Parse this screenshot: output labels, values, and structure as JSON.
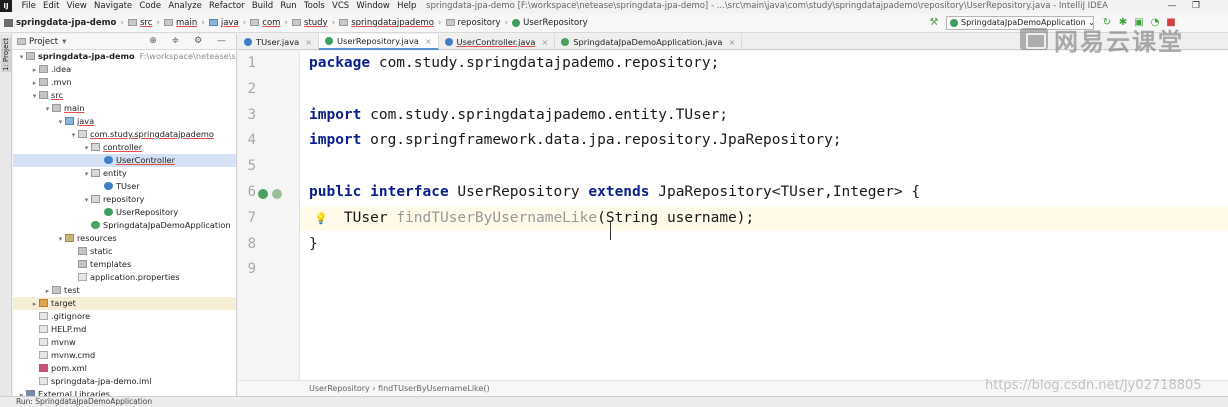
{
  "menubar": {
    "app_icon": "IJ",
    "items": [
      "File",
      "Edit",
      "View",
      "Navigate",
      "Code",
      "Analyze",
      "Refactor",
      "Build",
      "Run",
      "Tools",
      "VCS",
      "Window",
      "Help"
    ],
    "window_title": "springdata-jpa-demo [F:\\workspace\\netease\\springdata-jpa-demo] - ...\\src\\main\\java\\com\\study\\springdatajpademo\\repository\\UserRepository.java - IntelliJ IDEA",
    "minimize": "—",
    "maximize": "❐"
  },
  "navbar": {
    "crumbs": [
      "springdata-jpa-demo",
      "src",
      "main",
      "java",
      "com",
      "study",
      "springdatajpademo",
      "repository",
      "UserRepository"
    ],
    "run_config": "SpringdataJpaDemoApplication",
    "run_config_arrow": "⌄"
  },
  "project_panel": {
    "title": "Project",
    "title_arrow": "▾",
    "tools": "⊕ ≑ ⚙ —",
    "side_label": "1: Project",
    "tree": [
      {
        "label": "springdata-jpa-demo",
        "path": "F:\\workspace\\netease\\spring",
        "depth": 0,
        "arrow": "▾",
        "icon": "folder",
        "bold": true
      },
      {
        "label": ".idea",
        "depth": 1,
        "arrow": "▸",
        "icon": "folder"
      },
      {
        "label": ".mvn",
        "depth": 1,
        "arrow": "▸",
        "icon": "folder"
      },
      {
        "label": "src",
        "depth": 1,
        "arrow": "▾",
        "icon": "folder",
        "uline": true
      },
      {
        "label": "main",
        "depth": 2,
        "arrow": "▾",
        "icon": "folder",
        "uline": true
      },
      {
        "label": "java",
        "depth": 3,
        "arrow": "▾",
        "icon": "src-folder",
        "uline": true
      },
      {
        "label": "com.study.springdatajpademo",
        "depth": 4,
        "arrow": "▾",
        "icon": "pkg",
        "uline": true
      },
      {
        "label": "controller",
        "depth": 5,
        "arrow": "▾",
        "icon": "pkg",
        "uline": true
      },
      {
        "label": "UserController",
        "depth": 6,
        "arrow": "",
        "icon": "class",
        "selected": true,
        "uline": true
      },
      {
        "label": "entity",
        "depth": 5,
        "arrow": "▾",
        "icon": "pkg"
      },
      {
        "label": "TUser",
        "depth": 6,
        "arrow": "",
        "icon": "class"
      },
      {
        "label": "repository",
        "depth": 5,
        "arrow": "▾",
        "icon": "pkg"
      },
      {
        "label": "UserRepository",
        "depth": 6,
        "arrow": "",
        "icon": "iface"
      },
      {
        "label": "SpringdataJpaDemoApplication",
        "depth": 5,
        "arrow": "",
        "icon": "spring"
      },
      {
        "label": "resources",
        "depth": 3,
        "arrow": "▾",
        "icon": "res-folder"
      },
      {
        "label": "static",
        "depth": 4,
        "arrow": "",
        "icon": "folder"
      },
      {
        "label": "templates",
        "depth": 4,
        "arrow": "",
        "icon": "folder"
      },
      {
        "label": "application.properties",
        "depth": 4,
        "arrow": "",
        "icon": "file"
      },
      {
        "label": "test",
        "depth": 2,
        "arrow": "▸",
        "icon": "folder"
      },
      {
        "label": "target",
        "depth": 1,
        "arrow": "▸",
        "icon": "target-folder",
        "hl": true
      },
      {
        "label": ".gitignore",
        "depth": 1,
        "arrow": "",
        "icon": "file"
      },
      {
        "label": "HELP.md",
        "depth": 1,
        "arrow": "",
        "icon": "file"
      },
      {
        "label": "mvnw",
        "depth": 1,
        "arrow": "",
        "icon": "file"
      },
      {
        "label": "mvnw.cmd",
        "depth": 1,
        "arrow": "",
        "icon": "file"
      },
      {
        "label": "pom.xml",
        "depth": 1,
        "arrow": "",
        "icon": "maven"
      },
      {
        "label": "springdata-jpa-demo.iml",
        "depth": 1,
        "arrow": "",
        "icon": "file"
      },
      {
        "label": "External Libraries",
        "depth": 0,
        "arrow": "▸",
        "icon": "lib"
      }
    ]
  },
  "editor_tabs": [
    {
      "label": "TUser.java",
      "icon_color": "#3e7fc5"
    },
    {
      "label": "UserRepository.java",
      "icon_color": "#3c9e5c",
      "active": true
    },
    {
      "label": "UserController.java",
      "icon_color": "#3e7fc5",
      "uline": true
    },
    {
      "label": "SpringdataJpaDemoApplication.java",
      "icon_color": "#4aa05f"
    }
  ],
  "tab_close": "×",
  "editor": {
    "line_numbers": [
      "1",
      "2",
      "3",
      "4",
      "5",
      "6",
      "7",
      "8",
      "9"
    ],
    "lines": [
      [
        {
          "t": "package",
          "c": "kw"
        },
        {
          "t": " com.study.springdatajpademo.repository;"
        }
      ],
      [],
      [
        {
          "t": "import",
          "c": "kw"
        },
        {
          "t": " com.study.springdatajpademo.entity.TUser;"
        }
      ],
      [
        {
          "t": "import",
          "c": "kw"
        },
        {
          "t": " org.springframework.data.jpa.repository.JpaRepository;"
        }
      ],
      [],
      [
        {
          "t": "public",
          "c": "kw"
        },
        {
          "t": " "
        },
        {
          "t": "interface",
          "c": "kw"
        },
        {
          "t": " UserRepository "
        },
        {
          "t": "extends",
          "c": "kw"
        },
        {
          "t": " JpaRepository<TUser,Integer> {"
        }
      ],
      [
        {
          "t": "    TUser "
        },
        {
          "t": "findTUserByUsernameLike",
          "c": "method"
        },
        {
          "t": "(String username);"
        }
      ],
      [
        {
          "t": "}"
        }
      ],
      []
    ],
    "bulb": "💡"
  },
  "editor_breadcrumb": "UserRepository  ›  findTUserByUsernameLike()",
  "statusbar": "Run:    SpringdataJpaDemoApplication",
  "watermark_brand": "网易云课堂",
  "watermark_url": "https://blog.csdn.net/jy02718805",
  "colors": {
    "keyword": "#0b1f8c",
    "unused_method": "#999999",
    "selection": "#d5e1f5",
    "active_tab": "#5a8fd8",
    "current_line": "#fffbe8"
  }
}
